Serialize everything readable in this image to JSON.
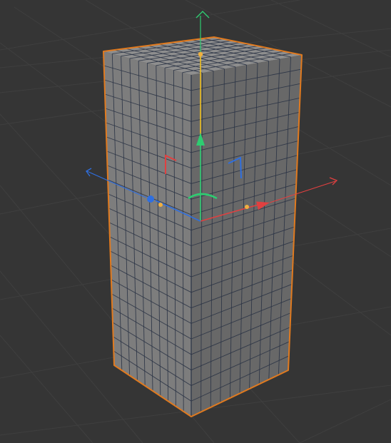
{
  "viewport": {
    "background_color": "#353535",
    "grid_line_color": "#3f3f3f",
    "grid_major_color": "#444444"
  },
  "object": {
    "type": "box",
    "subdivisions": {
      "width": 10,
      "height": 22,
      "depth": 10
    },
    "selected": true,
    "top_face_color": "#8e8e8e",
    "left_face_color": "#7d7d7d",
    "right_face_color": "#686868",
    "wireframe_color": "#2a3345",
    "selection_outline_color": "#e07a1f"
  },
  "gizmo": {
    "mode": "move",
    "x_axis_color": "#e04040",
    "y_axis_color": "#2ecc71",
    "z_axis_color": "#2f6fe0",
    "y_axis_highlight_color": "#f0c020",
    "handle_dot_color": "#f0b040"
  },
  "icons": {
    "x_axis_arrow": "arrow-right-icon",
    "y_axis_arrow": "arrow-up-icon",
    "z_axis_arrow": "arrow-left-icon",
    "rotate_handle": "rotate-arc-icon",
    "plane_handle_xy": "corner-bracket-icon",
    "plane_handle_zy": "corner-bracket-icon"
  }
}
